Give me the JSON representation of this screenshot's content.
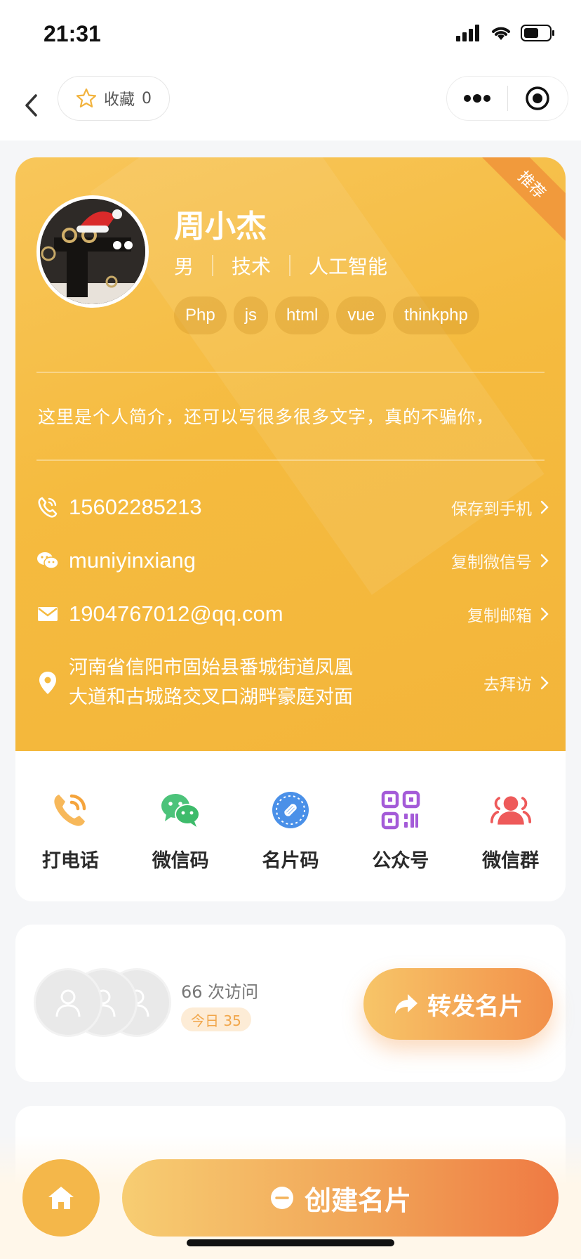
{
  "status_bar": {
    "time": "21:31"
  },
  "nav": {
    "favorite_label": "收藏",
    "favorite_count": "0"
  },
  "card": {
    "ribbon": "推荐",
    "name": "周小杰",
    "gender": "男",
    "department": "技术",
    "field": "人工智能",
    "tags": [
      "Php",
      "js",
      "html",
      "vue",
      "thinkphp"
    ],
    "intro": "这里是个人简介，还可以写很多很多文字，真的不骗你，",
    "phone": {
      "value": "15602285213",
      "action": "保存到手机"
    },
    "wechat": {
      "value": "muniyinxiang",
      "action": "复制微信号"
    },
    "email": {
      "value": "1904767012@qq.com",
      "action": "复制邮箱"
    },
    "address": {
      "line1": "河南省信阳市固始县番城街道凤凰",
      "line2": "大道和古城路交叉口湖畔豪庭对面",
      "action": "去拜访"
    }
  },
  "actions": [
    {
      "label": "打电话",
      "icon": "phone-call-icon",
      "color": "#f5a43c"
    },
    {
      "label": "微信码",
      "icon": "wechat-icon",
      "color": "#3ebb6b"
    },
    {
      "label": "名片码",
      "icon": "link-icon",
      "color": "#4a90e8"
    },
    {
      "label": "公众号",
      "icon": "qrcode-icon",
      "color": "#a45bd8"
    },
    {
      "label": "微信群",
      "icon": "group-icon",
      "color": "#ee5a5a"
    }
  ],
  "visits": {
    "count_text": "66 次访问",
    "today_text": "今日 35",
    "share_label": "转发名片"
  },
  "bottom": {
    "create_label": "创建名片"
  },
  "colors": {
    "accent": "#f5bb3f",
    "accent_dark": "#ef7a43"
  }
}
